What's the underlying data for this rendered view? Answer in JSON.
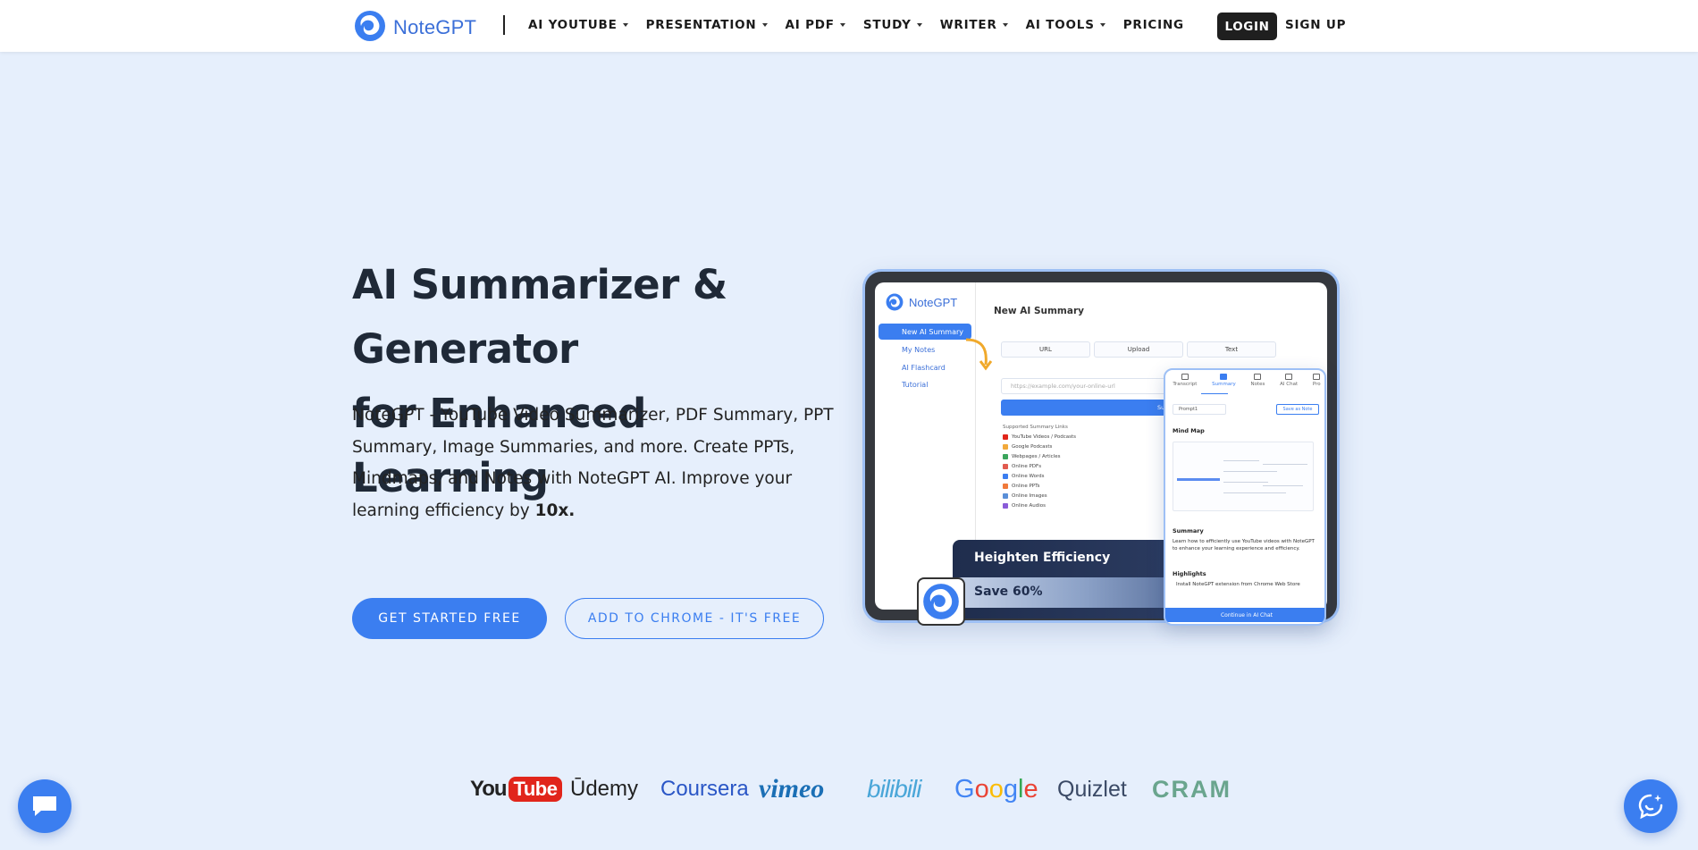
{
  "nav": {
    "brand": "NoteGPT",
    "divider": "|",
    "menu": [
      {
        "label": "AI YOUTUBE",
        "dropdown": true
      },
      {
        "label": "PRESENTATION",
        "dropdown": true
      },
      {
        "label": "AI PDF",
        "dropdown": true
      },
      {
        "label": "STUDY",
        "dropdown": true
      },
      {
        "label": "WRITER",
        "dropdown": true
      },
      {
        "label": "AI TOOLS",
        "dropdown": true
      },
      {
        "label": "PRICING",
        "dropdown": false
      }
    ],
    "login": "LOGIN",
    "signup": "SIGN UP"
  },
  "hero": {
    "title_line1": "AI Summarizer & Generator",
    "title_line2": "for Enhanced Learning",
    "description": "NoteGPT - YouTube Video Summarizer, PDF Summary, PPT Summary, Image Summaries, and more. Create PPTs, Mindmaps, and Notes with NoteGPT AI. Improve your learning efficiency by ",
    "description_bold": "10x.",
    "cta_primary": "GET STARTED FREE",
    "cta_secondary": "ADD TO CHROME - IT'S FREE"
  },
  "mockup": {
    "brand": "NoteGPT",
    "sidebar": [
      "New AI Summary",
      "My Notes",
      "AI Flashcard",
      "Tutorial"
    ],
    "main_title": "New AI Summary",
    "tabs": [
      "URL",
      "Upload",
      "Text"
    ],
    "url_placeholder": "https://example.com/your-online-url",
    "summarize_button": "Summarize Now",
    "supported_title": "Supported Summary Links",
    "supported_links": [
      {
        "label": "YouTube Videos / Podcasts",
        "color": "#e1251b"
      },
      {
        "label": "Google Podcasts",
        "color": "#f2a93b"
      },
      {
        "label": "Webpages / Articles",
        "color": "#3ba55c"
      },
      {
        "label": "Online PDFs",
        "color": "#e15b4f"
      },
      {
        "label": "Online Words",
        "color": "#3b7ef0"
      },
      {
        "label": "Online PPTs",
        "color": "#f07a3b"
      },
      {
        "label": "Online Images",
        "color": "#5a8fd8"
      },
      {
        "label": "Online Audios",
        "color": "#8a5cd8"
      }
    ],
    "efficiency_title": "Heighten Efficiency",
    "efficiency_save": "Save 60%",
    "panel": {
      "tabs": [
        "Transcript",
        "Summary",
        "Notes",
        "AI Chat",
        "Pro"
      ],
      "active_tab": "Summary",
      "prompt": "Prompt1",
      "save_note": "Save as Note",
      "mind_map": "Mind Map",
      "summary_heading": "Summary",
      "summary_text": "Learn how to efficiently use YouTube videos with NoteGPT to enhance your learning experience and efficiency.",
      "highlights_heading": "Highlights",
      "highlight_1": "Install NoteGPT extension from Chrome Web Store",
      "continue_button": "Continue in AI Chat"
    }
  },
  "logos": [
    "YouTube",
    "Udemy",
    "Coursera",
    "vimeo",
    "bilibili",
    "Google",
    "Quizlet",
    "CRAM"
  ],
  "logo_parts": {
    "youtube_you": "You",
    "youtube_tube": "Tube",
    "udemy": "Ūdemy",
    "coursera": "Coursera",
    "vimeo": "vimeo",
    "bilibili": "bilibili",
    "google": [
      "G",
      "o",
      "o",
      "g",
      "l",
      "e"
    ],
    "quizlet": "Quizlet",
    "cram": "CRAM"
  },
  "colors": {
    "accent": "#3b7ef0",
    "page_bg": "#e6effc",
    "brand_text": "#3b6fd8",
    "google": [
      "#4285f4",
      "#ea4335",
      "#fbbc05",
      "#4285f4",
      "#34a853",
      "#ea4335"
    ]
  }
}
